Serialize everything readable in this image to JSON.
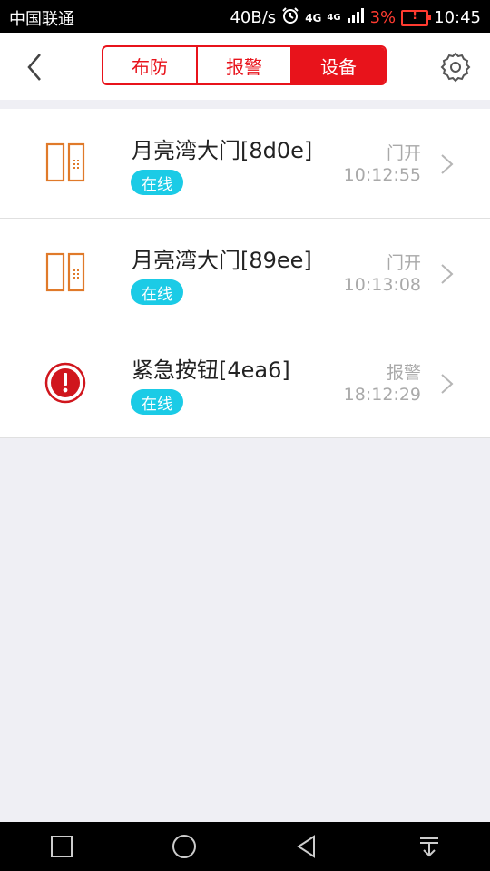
{
  "status": {
    "carrier": "中国联通",
    "speed": "40B/s",
    "net1": "4G",
    "net2": "4G",
    "battery": "3%",
    "time": "10:45"
  },
  "header": {
    "tabs": [
      "布防",
      "报警",
      "设备"
    ],
    "active_tab": "设备"
  },
  "devices": [
    {
      "name": "月亮湾大门[8d0e]",
      "badge": "在线",
      "state": "门开",
      "time": "10:12:55",
      "icon": "door-sensor-icon"
    },
    {
      "name": "月亮湾大门[89ee]",
      "badge": "在线",
      "state": "门开",
      "time": "10:13:08",
      "icon": "door-sensor-icon"
    },
    {
      "name": "紧急按钮[4ea6]",
      "badge": "在线",
      "state": "报警",
      "time": "18:12:29",
      "icon": "emergency-button-icon"
    }
  ],
  "colors": {
    "accent": "#e8131b",
    "online_badge": "#1bcbe6",
    "door_icon": "#e07a2a",
    "emergency_icon": "#d0161d"
  }
}
